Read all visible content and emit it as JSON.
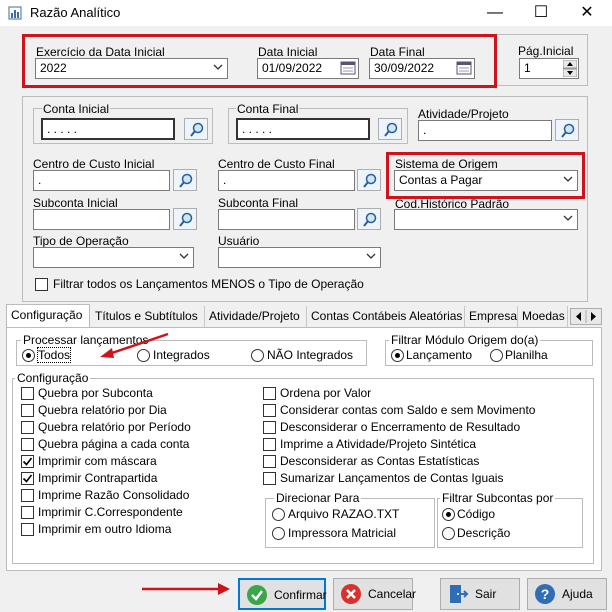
{
  "window": {
    "title": "Razão Analítico",
    "minimize": "—",
    "maximize": "☐",
    "close": "✕"
  },
  "period": {
    "exercicio_label": "Exercício da Data Inicial",
    "exercicio_value": "2022",
    "data_inicial_label": "Data Inicial",
    "data_inicial_value": "01/09/2022",
    "data_final_label": "Data Final",
    "data_final_value": "30/09/2022",
    "pag_inicial_label": "Pág.Inicial",
    "pag_inicial_value": "1"
  },
  "filters": {
    "conta_inicial_label": "Conta Inicial",
    "conta_inicial_value": ". . . . .",
    "conta_final_label": "Conta Final",
    "conta_final_value": ". . . . .",
    "atividade_label": "Atividade/Projeto",
    "atividade_value": ".",
    "cc_inicial_label": "Centro de Custo Inicial",
    "cc_inicial_value": ".",
    "cc_final_label": "Centro de Custo Final",
    "cc_final_value": ".",
    "sistema_origem_label": "Sistema de Origem",
    "sistema_origem_value": "Contas a Pagar",
    "subconta_inicial_label": "Subconta Inicial",
    "subconta_final_label": "Subconta Final",
    "cod_historico_label": "Cod.Histórico Padrão",
    "tipo_operacao_label": "Tipo de Operação",
    "usuario_label": "Usuário",
    "filtrar_menos_label": "Filtrar todos os Lançamentos MENOS o Tipo de Operação"
  },
  "tabs": [
    "Configuração",
    "Títulos e Subtítulos",
    "Atividade/Projeto",
    "Contas Contábeis Aleatórias",
    "Empresa",
    "Moedas"
  ],
  "processar": {
    "title": "Processar lançamentos",
    "options": [
      "Todos",
      "Integrados",
      "NÃO Integrados"
    ],
    "selected": 0
  },
  "filtrar_modulo": {
    "title": "Filtrar Módulo Origem do(a)",
    "options": [
      "Lançamento",
      "Planilha"
    ],
    "selected": 0
  },
  "configuracao": {
    "title": "Configuração",
    "left": [
      {
        "label": "Quebra por Subconta",
        "checked": false
      },
      {
        "label": "Quebra relatório por Dia",
        "checked": false
      },
      {
        "label": "Quebra relatório por Período",
        "checked": false
      },
      {
        "label": "Quebra página a cada conta",
        "checked": false
      },
      {
        "label": "Imprimir com máscara",
        "checked": true
      },
      {
        "label": "Imprimir Contrapartida",
        "checked": true
      },
      {
        "label": "Imprime Razão Consolidado",
        "checked": false
      },
      {
        "label": "Imprimir C.Correspondente",
        "checked": false
      },
      {
        "label": "Imprimir em outro Idioma",
        "checked": false
      }
    ],
    "right": [
      {
        "label": "Ordena por Valor",
        "checked": false
      },
      {
        "label": "Considerar contas com Saldo e sem Movimento",
        "checked": false
      },
      {
        "label": "Desconsiderar o Encerramento de Resultado",
        "checked": false
      },
      {
        "label": "Imprime a Atividade/Projeto Sintética",
        "checked": false
      },
      {
        "label": "Desconsiderar as Contas Estatísticas",
        "checked": false
      },
      {
        "label": "Sumarizar Lançamentos de Contas Iguais",
        "checked": false
      }
    ],
    "direcionar": {
      "title": "Direcionar  Para",
      "options": [
        "Arquivo RAZAO.TXT",
        "Impressora Matricial"
      ],
      "selected": -1
    },
    "filtrar_subcontas": {
      "title": "Filtrar Subcontas por",
      "options": [
        "Código",
        "Descrição"
      ],
      "selected": 0
    }
  },
  "buttons": {
    "confirmar": "Confirmar",
    "cancelar": "Cancelar",
    "sair": "Sair",
    "ajuda": "Ajuda"
  },
  "colors": {
    "highlight_red": "#d0121b",
    "focus_blue": "#0078d7"
  }
}
